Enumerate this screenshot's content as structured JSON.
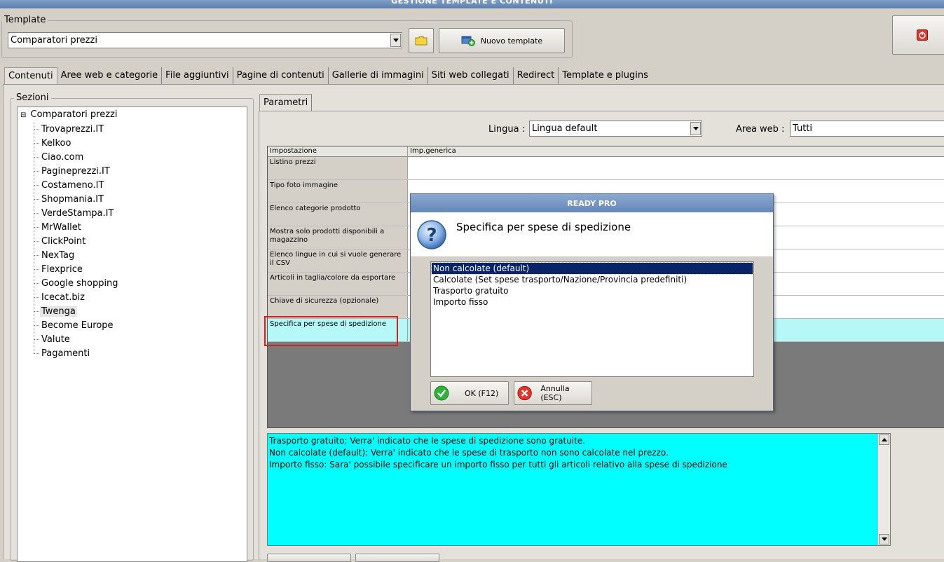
{
  "window": {
    "title": "GESTIONE TEMPLATE E CONTENUTI"
  },
  "template_group": {
    "legend": "Template",
    "selected": "Comparatori prezzi",
    "new_template_label": "Nuovo template"
  },
  "tabs": [
    {
      "label": "Contenuti",
      "active": true
    },
    {
      "label": "Aree web e categorie"
    },
    {
      "label": "File aggiuntivi"
    },
    {
      "label": "Pagine di contenuti"
    },
    {
      "label": "Gallerie di immagini"
    },
    {
      "label": "Siti web collegati"
    },
    {
      "label": "Redirect"
    },
    {
      "label": "Template e plugins"
    }
  ],
  "sections": {
    "legend": "Sezioni",
    "root": "Comparatori prezzi",
    "root_expander": "⊟",
    "items": [
      "Trovaprezzi.IT",
      "Kelkoo",
      "Ciao.com",
      "Pagineprezzi.IT",
      "Costameno.IT",
      "Shopmania.IT",
      "VerdeStampa.IT",
      "MrWallet",
      "ClickPoint",
      "NexTag",
      "Flexprice",
      "Google shopping",
      "Icecat.biz",
      "Twenga",
      "Become Europe",
      "Valute",
      "Pagamenti"
    ],
    "selected_index": 13
  },
  "params": {
    "tab_label": "Parametri",
    "lingua_label": "Lingua :",
    "lingua_value": "Lingua default",
    "area_label": "Area web :",
    "area_value": "Tutti",
    "col_setting": "Impostazione",
    "col_value": "Imp.generica",
    "rows": [
      "Listino prezzi",
      "Tipo foto immagine",
      "Elenco categorie prodotto",
      "Mostra solo prodotti disponibili a magazzino",
      "Elenco lingue in cui si vuole generare il CSV",
      "Articoli in taglia/colore da esportare",
      "Chiave di sicurezza (opzionale)",
      "Specifica per spese di spedizione"
    ],
    "highlight_index": 7
  },
  "info": {
    "lines": [
      "Trasporto gratuito: Verra' indicato che le spese di spedizione sono gratuite.",
      "Non calcolate (default): Verra' indicato che le spese di trasporto non sono calcolate nel prezzo.",
      "Importo fisso: Sara' possibile specificare un importo fisso per tutti gli articoli relativo alla spese di spedizione"
    ]
  },
  "dialog": {
    "title": "READY PRO",
    "heading": "Specifica per spese di spedizione",
    "options": [
      "Non calcolate (default)",
      "Calcolate (Set spese trasporto/Nazione/Provincia predefiniti)",
      "Trasporto gratuito",
      "Importo fisso"
    ],
    "selected_index": 0,
    "ok_label": "OK (F12)",
    "cancel_label": "Annulla (ESC)"
  },
  "colors": {
    "highlight_red": "#e01b1b",
    "info_bg": "#00ffff",
    "selection": "#0a246a"
  }
}
